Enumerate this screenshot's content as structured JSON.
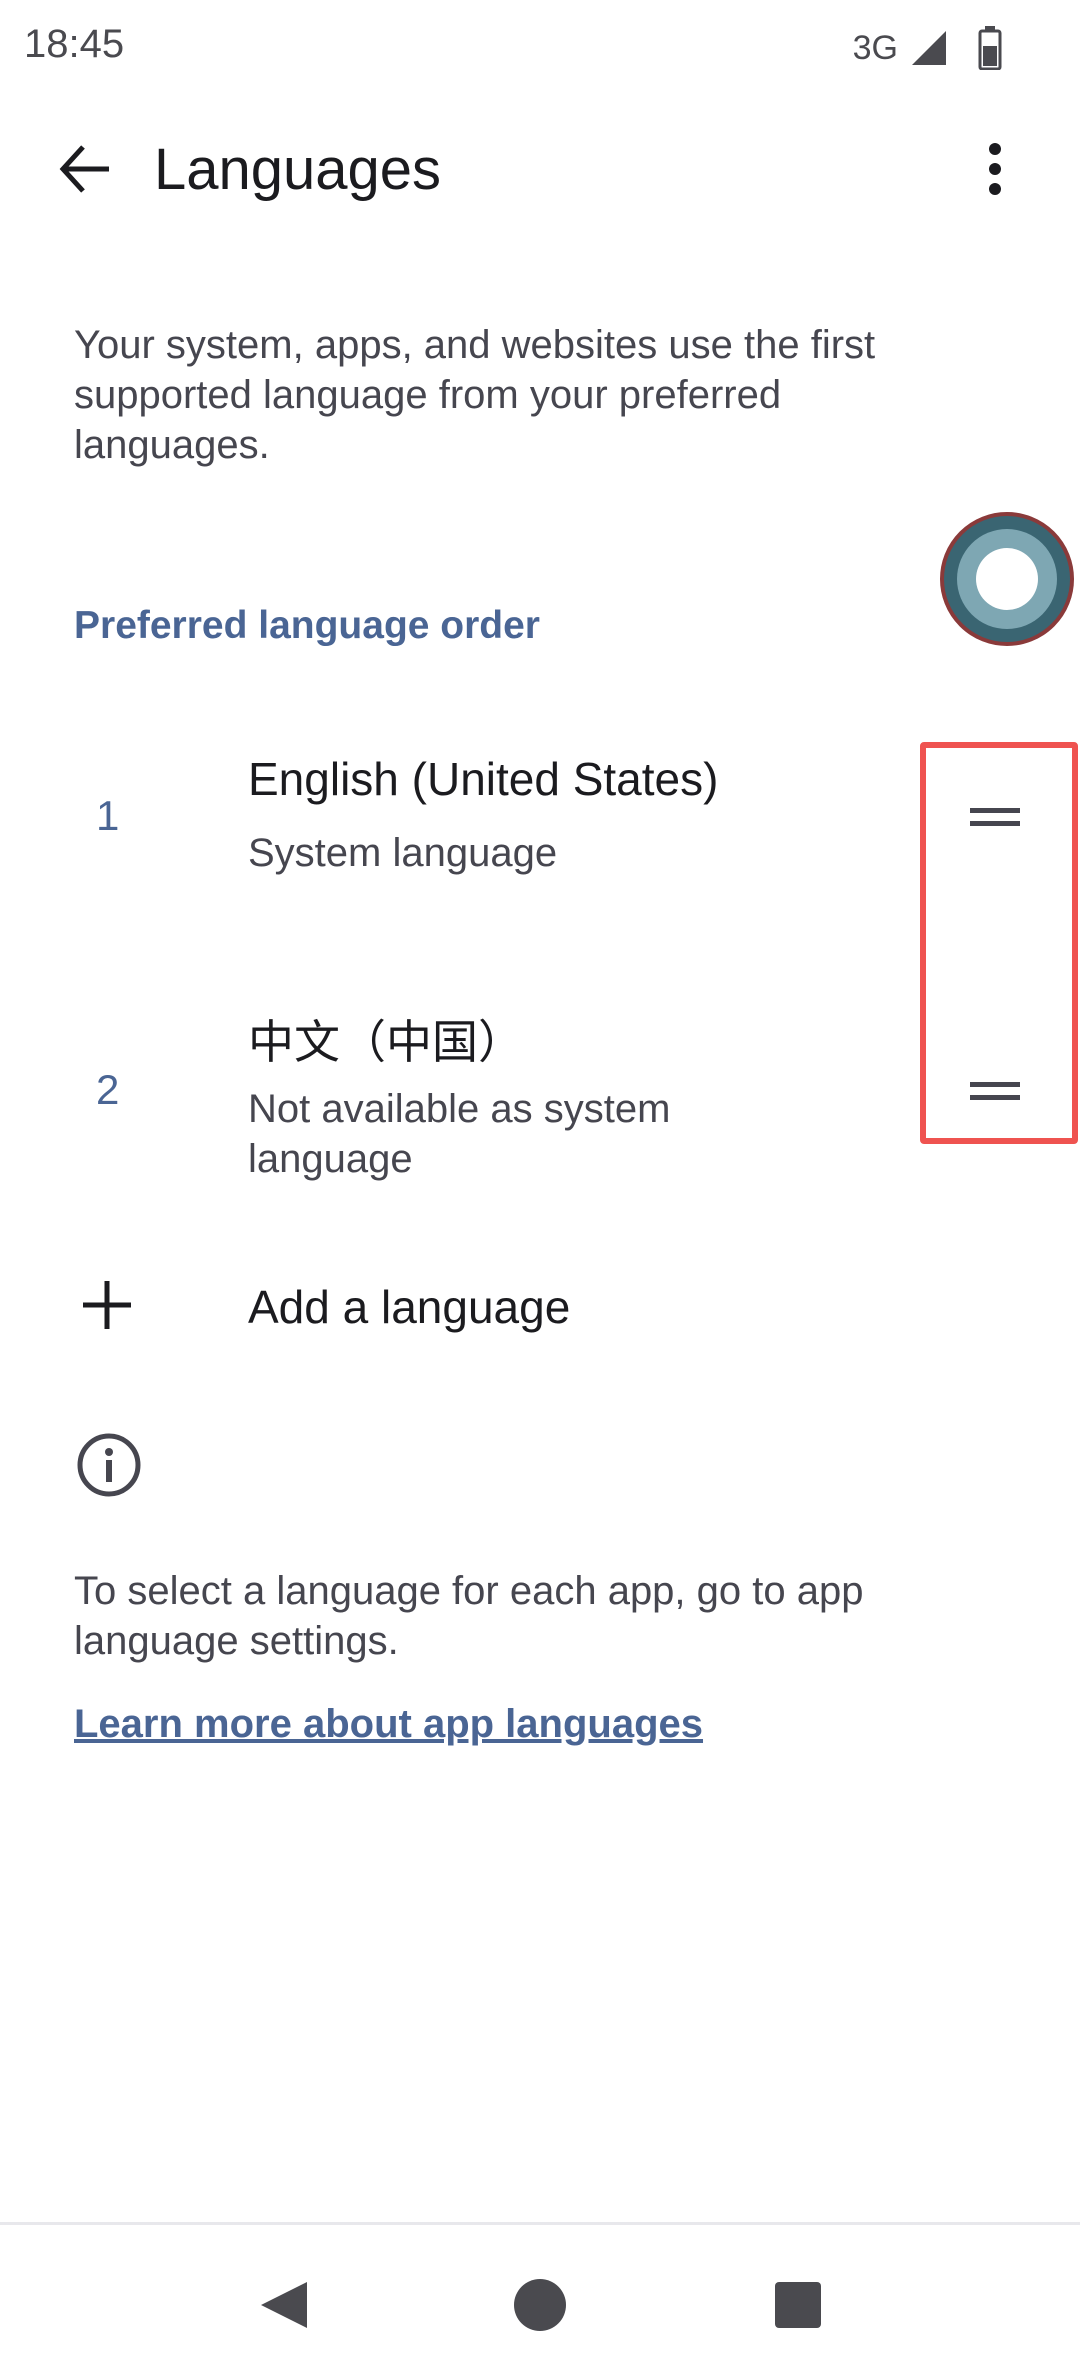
{
  "status_bar": {
    "time": "18:45",
    "network": "3G"
  },
  "app_bar": {
    "title": "Languages",
    "back_icon": "arrow-left-icon",
    "menu_icon": "more-vert-icon"
  },
  "intro": "Your system, apps, and websites use the first supported language from your preferred languages.",
  "section_header": "Preferred language order",
  "languages": [
    {
      "index": "1",
      "name": "English (United States)",
      "subtitle": "System language"
    },
    {
      "index": "2",
      "name": "中文（中国）",
      "subtitle": "Not available as system language"
    }
  ],
  "add_language": "Add a language",
  "info_text": "To select a language for each app, go to app language settings.",
  "learn_more": "Learn more about app languages",
  "colors": {
    "accent": "#4a6594",
    "highlight": "#ef5350",
    "text": "#1b1b1f",
    "secondary_text": "#46464f"
  }
}
